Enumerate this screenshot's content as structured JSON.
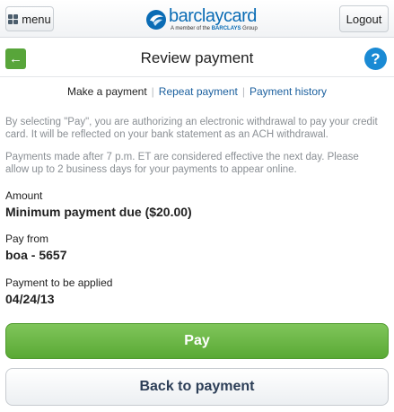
{
  "header": {
    "menu_label": "menu",
    "logout_label": "Logout",
    "brand_name": "barclaycard",
    "brand_tagline_prefix": "A member of the",
    "brand_tagline_group": "BARCLAYS",
    "brand_tagline_suffix": "Group",
    "brand_color": "#0a6cb5"
  },
  "titlebar": {
    "title": "Review payment",
    "back_icon": "left-arrow-icon",
    "help_label": "?"
  },
  "subnav": {
    "items": [
      {
        "label": "Make a payment",
        "active": true
      },
      {
        "label": "Repeat payment",
        "active": false
      },
      {
        "label": "Payment history",
        "active": false
      }
    ],
    "separator": "|"
  },
  "notes": {
    "authorization": "By selecting \"Pay\", you are authorizing an electronic withdrawal to pay your credit card. It will be reflected on your bank statement as an ACH withdrawal.",
    "timing": "Payments made after 7 p.m. ET are considered effective the next day. Please allow up to 2 business days for your payments to appear online."
  },
  "details": {
    "amount_label": "Amount",
    "amount_value": "Minimum payment due ($20.00)",
    "payfrom_label": "Pay from",
    "payfrom_value": "boa - 5657",
    "date_label": "Payment to be applied",
    "date_value": "04/24/13"
  },
  "actions": {
    "pay_label": "Pay",
    "back_label": "Back to payment",
    "pay_color": "#5aa935"
  }
}
